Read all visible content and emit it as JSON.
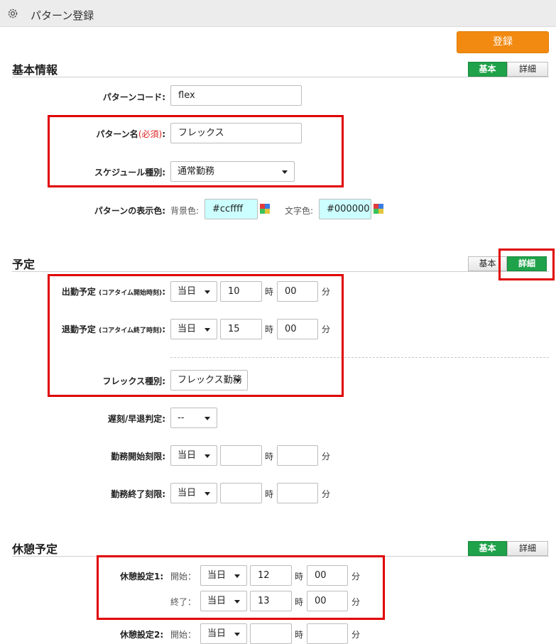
{
  "header": {
    "title": "パターン登録",
    "icon": "gear-icon"
  },
  "actions": {
    "register": "登録"
  },
  "colors": {
    "register": "#f28a12",
    "toggle_active": "#1fa24a",
    "highlight": "#e00000",
    "swatch": "#ccffff"
  },
  "basic_info": {
    "title": "基本情報",
    "toggle": {
      "basic": "基本",
      "detail": "詳細",
      "active": "basic"
    },
    "pattern_code": {
      "label": "パターンコード:",
      "value": "flex"
    },
    "pattern_name": {
      "label": "パターン名",
      "required": "(必須)",
      "colon": ":",
      "value": "フレックス"
    },
    "schedule_type": {
      "label": "スケジュール種別:",
      "value": "通常勤務"
    },
    "display_color": {
      "label": "パターンの表示色:",
      "bg_label": "背景色:",
      "bg_value": "#ccffff",
      "text_label": "文字色:",
      "text_value": "#000000"
    }
  },
  "schedule": {
    "title": "予定",
    "toggle": {
      "basic": "基本",
      "detail": "詳細",
      "active": "detail"
    },
    "start": {
      "label": "出勤予定",
      "note": "(コアタイム開始時刻)",
      "colon": ":",
      "day": "当日",
      "hour": "10",
      "minute": "00"
    },
    "end": {
      "label": "退勤予定",
      "note": "(コアタイム終了時刻)",
      "colon": ":",
      "day": "当日",
      "hour": "15",
      "minute": "00"
    },
    "flex_type": {
      "label": "フレックス種別:",
      "value": "フレックス勤務"
    },
    "late_judge": {
      "label": "遅刻/早退判定:",
      "value": "--"
    },
    "work_start_limit": {
      "label": "勤務開始刻限:",
      "day": "当日",
      "hour": "",
      "minute": ""
    },
    "work_end_limit": {
      "label": "勤務終了刻限:",
      "day": "当日",
      "hour": "",
      "minute": ""
    },
    "hour_unit": "時",
    "minute_unit": "分"
  },
  "break_schedule": {
    "title": "休憩予定",
    "toggle": {
      "basic": "基本",
      "detail": "詳細",
      "active": "basic"
    },
    "break1": {
      "label": "休憩設定1:",
      "start_label": "開始：",
      "start_day": "当日",
      "start_hour": "12",
      "start_minute": "00",
      "end_label": "終了：",
      "end_day": "当日",
      "end_hour": "13",
      "end_minute": "00"
    },
    "break2": {
      "label": "休憩設定2:",
      "start_label": "開始：",
      "start_day": "当日",
      "start_hour": "",
      "start_minute": ""
    },
    "hour_unit": "時",
    "minute_unit": "分"
  }
}
